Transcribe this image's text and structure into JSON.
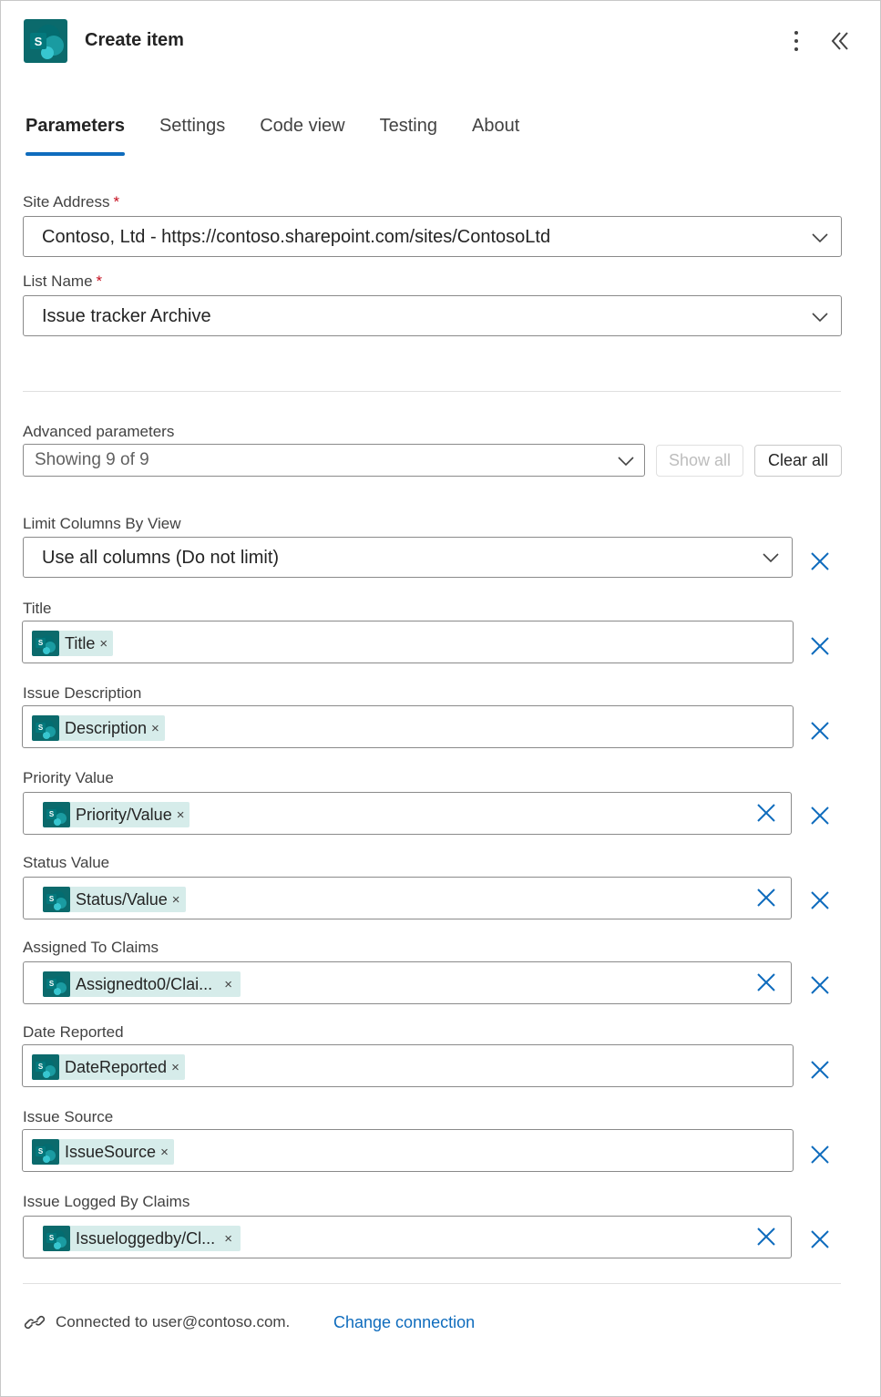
{
  "header": {
    "logo_letter": "S",
    "title": "Create item"
  },
  "tabs": [
    {
      "label": "Parameters",
      "active": true
    },
    {
      "label": "Settings",
      "active": false
    },
    {
      "label": "Code view",
      "active": false
    },
    {
      "label": "Testing",
      "active": false
    },
    {
      "label": "About",
      "active": false
    }
  ],
  "site_address": {
    "label": "Site Address",
    "required_mark": "*",
    "value": "Contoso, Ltd - https://contoso.sharepoint.com/sites/ContosoLtd"
  },
  "list_name": {
    "label": "List Name",
    "required_mark": "*",
    "value": "Issue tracker Archive"
  },
  "advanced": {
    "label": "Advanced parameters",
    "value": "Showing 9 of 9",
    "show_all": "Show all",
    "clear_all": "Clear all"
  },
  "limit_columns": {
    "label": "Limit Columns By View",
    "value": "Use all columns (Do not limit)"
  },
  "fields": [
    {
      "label": "Title",
      "token": "Title",
      "token_x": "×"
    },
    {
      "label": "Issue Description",
      "token": "Description",
      "token_x": "×"
    },
    {
      "label": "Priority Value",
      "token": "Priority/Value",
      "token_x": "×"
    },
    {
      "label": "Status Value",
      "token": "Status/Value",
      "token_x": "×"
    },
    {
      "label": "Assigned To Claims",
      "token": "Assignedto0/Clai...",
      "token_x": "×"
    },
    {
      "label": "Date Reported",
      "token": "DateReported",
      "token_x": "×"
    },
    {
      "label": "Issue Source",
      "token": "IssueSource",
      "token_x": "×"
    },
    {
      "label": "Issue Logged By Claims",
      "token": "Issueloggedby/Cl...",
      "token_x": "×"
    }
  ],
  "footer": {
    "connected_text": "Connected to user@contoso.com.",
    "change_link": "Change connection"
  },
  "colors": {
    "accent": "#0f6cbd",
    "sharepoint": "#036c70",
    "token_bg": "#d6ecea",
    "required": "#c50f1f"
  },
  "icons": [
    "sharepoint-logo-icon",
    "more-vertical-icon",
    "collapse-double-chevron-icon",
    "chevron-down-icon",
    "dismiss-icon",
    "link-icon"
  ]
}
